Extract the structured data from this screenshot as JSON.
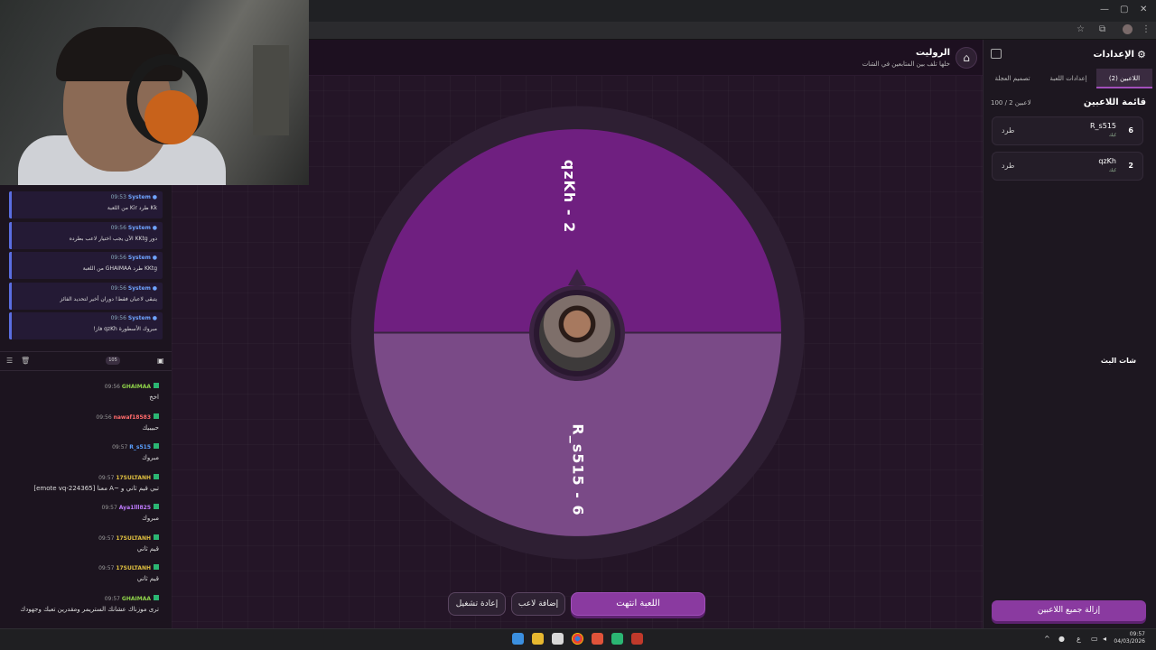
{
  "header": {
    "title": "الروليت",
    "subtitle": "خلها تلف بين المتابعين في الشات"
  },
  "right_panel": {
    "title": "الإعدادات",
    "tabs": [
      "اللاعبين (2)",
      "إعدادات اللعبة",
      "تصميم العجلة"
    ],
    "list_title": "قائمة اللاعبين",
    "list_count": "100 / 2 لاعبين",
    "players": [
      {
        "num": "6",
        "name": "R_s515",
        "tag": "كيك",
        "kick": "طرد"
      },
      {
        "num": "2",
        "name": "qzKh",
        "tag": "كيك",
        "kick": "طرد"
      }
    ],
    "remove_all": "إزالة جميع اللاعبين"
  },
  "wheel": {
    "slices": [
      {
        "label": "qzKh - 2",
        "color": "#6f1f80"
      },
      {
        "label": "R_s515 - 6",
        "color": "#7a4a87"
      }
    ]
  },
  "buttons": {
    "game_over": "اللعبة انتهت",
    "add_player": "إضافة لاعب",
    "restart": "إعادة تشغيل"
  },
  "system_messages": [
    {
      "time": "09:53",
      "name": "System",
      "text": "Kk طرد Kir من اللعبة"
    },
    {
      "time": "09:56",
      "name": "System",
      "text": "دور KKtg الآن يجب اختيار لاعب بطرده"
    },
    {
      "time": "09:56",
      "name": "System",
      "text": "KKtg طرد GHAIMAA من اللعبة"
    },
    {
      "time": "09:56",
      "name": "System",
      "text": "يتبقى لاعبان فقط! دوران أخير لتحديد الفائز"
    },
    {
      "time": "09:56",
      "name": "System",
      "text": "مبروك الأسطورة qzKh فاز!"
    }
  ],
  "chat": {
    "title": "شات البث",
    "count": "105",
    "messages": [
      {
        "time": "09:56",
        "user": "GHAIMAA",
        "color": "#8fd34a",
        "text": "اخخ"
      },
      {
        "time": "09:56",
        "user": "nawaf18583",
        "color": "#ff6b6b",
        "text": "حبيبيك"
      },
      {
        "time": "09:57",
        "user": "R_s515",
        "color": "#5aa0ff",
        "text": "مبروك"
      },
      {
        "time": "09:57",
        "user": "17SULTANH",
        "color": "#e0c040",
        "text": "تبي قيم ثاني و ~A معنا [emote vq-224365]"
      },
      {
        "time": "09:57",
        "user": "Aya1lll825",
        "color": "#c07cff",
        "text": "مبروك"
      },
      {
        "time": "09:57",
        "user": "17SULTANH",
        "color": "#e0c040",
        "text": "قيم ثاني"
      },
      {
        "time": "09:57",
        "user": "17SULTANH",
        "color": "#e0c040",
        "text": "قيم ثاني"
      },
      {
        "time": "09:57",
        "user": "GHAIMAA",
        "color": "#8fd34a",
        "text": "ترى موزناك عشانك الستريمر ومقدرين تعبك وجهودك"
      }
    ]
  },
  "taskbar": {
    "lang": "ع",
    "time": "09:57",
    "date": "04/03/2026"
  }
}
